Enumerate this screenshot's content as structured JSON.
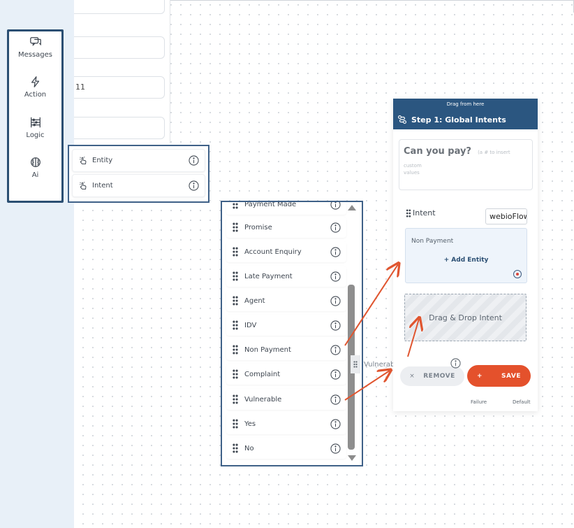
{
  "prop_panel": {
    "fields": [
      "",
      "",
      "11",
      ""
    ]
  },
  "toolbar": {
    "items": [
      {
        "label": "Messages",
        "icon": "chat-bubbles-icon"
      },
      {
        "label": "Action",
        "icon": "lightning-icon"
      },
      {
        "label": "Logic",
        "icon": "abacus-icon"
      },
      {
        "label": "Ai",
        "icon": "brain-icon"
      }
    ]
  },
  "sub_menu": {
    "items": [
      {
        "label": "Entity",
        "icon": "hand-pointer-icon"
      },
      {
        "label": "Intent",
        "icon": "hand-pointer-icon"
      }
    ]
  },
  "intent_list": {
    "items": [
      "Payment Made",
      "Promise",
      "Account Enquiry",
      "Late Payment",
      "Agent",
      "IDV",
      "Non Payment",
      "Complaint",
      "Vulnerable",
      "Yes",
      "No"
    ]
  },
  "dragging_item": {
    "label": "Vulnerable"
  },
  "node": {
    "drag_hint": "Drag from here",
    "title": "Step 1: Global Intents",
    "message_text": "Can you pay?",
    "message_hint_1": "(a # to insert custom",
    "message_hint_2": "values",
    "intent_label": "Intent",
    "flow_value": "webioFlow",
    "entity_card": {
      "name": "Non Payment",
      "add_label": "+ Add Entity"
    },
    "drop_zone_label": "Drag & Drop Intent",
    "remove_label": "REMOVE",
    "remove_icon": "×",
    "save_label": "SAVE",
    "save_icon": "+",
    "footer_failure": "Failure",
    "footer_default": "Default"
  },
  "colors": {
    "panel_border": "#3f6188",
    "node_header": "#2b5680",
    "save_button": "#e4512c",
    "arrow": "#e0552f",
    "left_strip": "#e8f0f8"
  }
}
